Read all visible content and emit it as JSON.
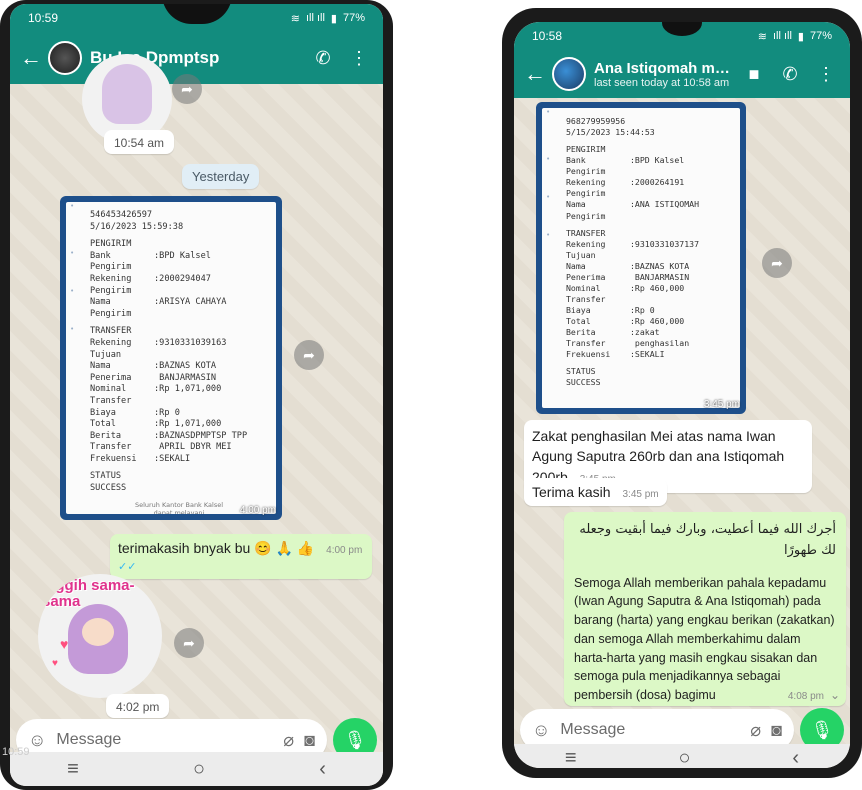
{
  "left_phone": {
    "status": {
      "time": "10:59",
      "signal": "ıll ıll",
      "battery": "77%"
    },
    "header": {
      "name": "Bu Ica Dpmptsp"
    },
    "messages": {
      "top_time": "10:54 am",
      "date_divider": "Yesterday",
      "receipt": {
        "ref": "546453426597",
        "datetime": "5/16/2023 15:59:38",
        "section1": "PENGIRIM",
        "bank_label": "Bank Pengirim",
        "bank_value": ":BPD Kalsel",
        "rek_label": "Rekening\nPengirim",
        "rek_value": ":2000294047",
        "nama_label": "Nama Pengirim",
        "nama_value": ":ARISYA CAHAYA",
        "section2": "TRANSFER",
        "rekt_label": "Rekening\nTujuan",
        "rekt_value": ":9310331039163",
        "pen_label": "Nama Penerima",
        "pen_value": ":BAZNAS KOTA\n BANJARMASIN",
        "nom_label": "Nominal\nTransfer",
        "nom_value": ":Rp 1,071,000",
        "biaya_label": "Biaya",
        "biaya_value": ":Rp 0",
        "total_label": "Total",
        "total_value": ":Rp 1,071,000",
        "berita_label": "Berita\nTransfer",
        "berita_value": ":BAZNASDPMPTSP TPP\n APRIL DBYR MEI",
        "frek_label": "Frekuensi",
        "frek_value": ":SEKALI",
        "status_label": "STATUS",
        "status_value": "SUCCESS",
        "footer": "Seluruh Kantor Bank Kalsel\ndapat melayani\nBuka Rekening dan Transaksi Syariah",
        "time": "4:00 pm"
      },
      "out_text": "terimakasih bnyak bu 😊 🙏 👍",
      "out_time": "4:00 pm",
      "sticker_text": "Inggih sama-sama",
      "sticker_time": "4:02 pm"
    },
    "composer": {
      "placeholder": "Message"
    },
    "corner_time": "10:59"
  },
  "right_phone": {
    "status": {
      "time": "10:58",
      "battery": "77%"
    },
    "header": {
      "name": "Ana Istiqomah muzakki",
      "last_seen": "last seen today at 10:58 am"
    },
    "messages": {
      "receipt": {
        "ref": "968279959956",
        "datetime": "5/15/2023 15:44:53",
        "section1": "PENGIRIM",
        "bank_label": "Bank Pengirim",
        "bank_value": ":BPD Kalsel",
        "rek_label": "Rekening\nPengirim",
        "rek_value": ":2000264191",
        "nama_label": "Nama Pengirim",
        "nama_value": ":ANA ISTIQOMAH",
        "section2": "TRANSFER",
        "rekt_label": "Rekening\nTujuan",
        "rekt_value": ":9310331037137",
        "pen_label": "Nama Penerima",
        "pen_value": ":BAZNAS KOTA\n BANJARMASIN",
        "nom_label": "Nominal\nTransfer",
        "nom_value": ":Rp 460,000",
        "biaya_label": "Biaya",
        "biaya_value": ":Rp 0",
        "total_label": "Total",
        "total_value": ":Rp 460,000",
        "berita_label": "Berita\nTransfer",
        "berita_value": ":zakat\n penghasilan",
        "frek_label": "Frekuensi",
        "frek_value": ":SEKALI",
        "status_label": "STATUS",
        "status_value": "SUCCESS",
        "time": "3:45 pm"
      },
      "in1_text": "Zakat penghasilan Mei atas nama Iwan Agung Saputra 260rb dan ana Istiqomah 200rb",
      "in1_time": "3:45 pm",
      "in2_text": "Terima kasih",
      "in2_time": "3:45 pm",
      "out_arabic": "أجرك الله فيما أعطيت، وبارك فيما أبقيت وجعله لك طهورًا",
      "out_text": "Semoga Allah memberikan pahala kepadamu (Iwan Agung Saputra & Ana Istiqomah) pada barang (harta) yang engkau berikan (zakatkan) dan semoga Allah memberkahimu dalam harta-harta yang masih engkau sisakan dan semoga pula menjadikannya sebagai pembersih (dosa) bagimu",
      "out_time": "4:08 pm"
    },
    "composer": {
      "placeholder": "Message"
    }
  },
  "colors": {
    "header": "#128c7e",
    "outgoing": "#dcf8c6",
    "mic": "#25d366",
    "ticks": "#34b7f1"
  }
}
